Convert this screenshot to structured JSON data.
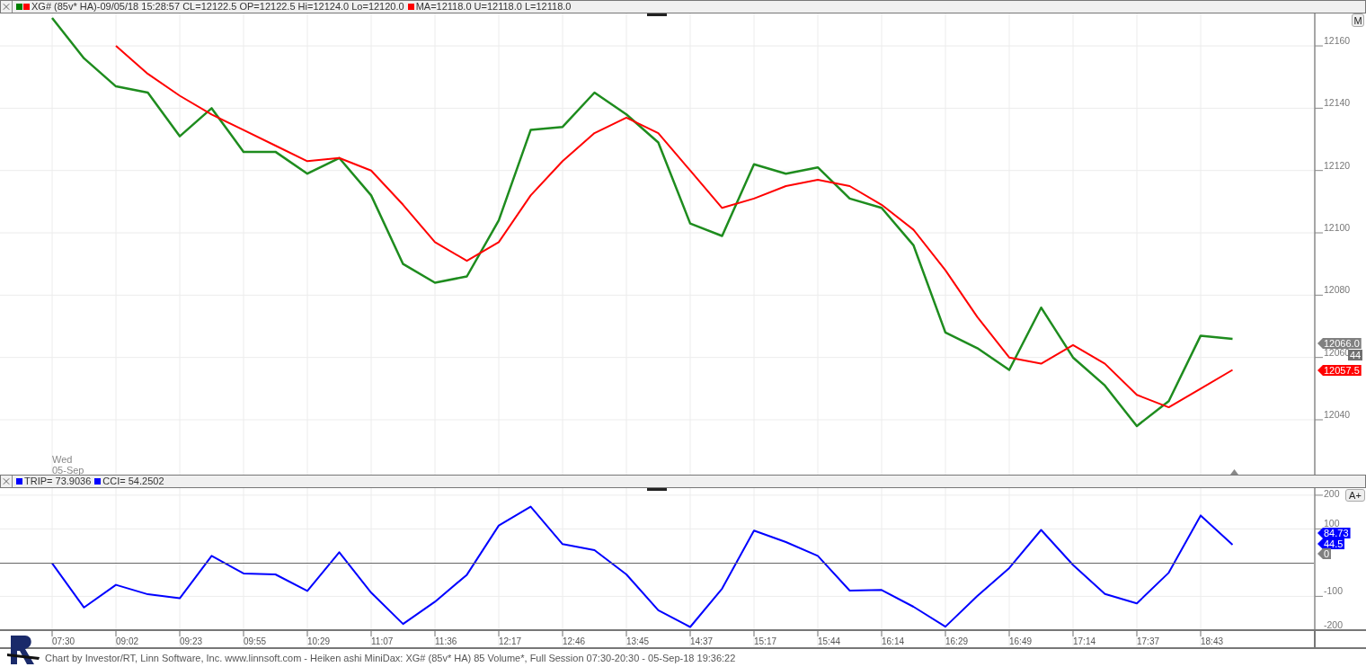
{
  "header": {
    "items": [
      {
        "swatches": [
          {
            "color": "#008000"
          },
          {
            "color": "#ff0000"
          }
        ],
        "text": "XG# (85v* HA)-09/05/18 15:28:57 CL=12122.5 OP=12122.5 Hi=12124.0 Lo=12120.0"
      },
      {
        "swatches": [
          {
            "color": "#ff0000"
          }
        ],
        "text": "MA=12118.0 U=12118.0 L=12118.0"
      }
    ]
  },
  "price_panel": {
    "date_label": [
      "Wed",
      "05-Sep"
    ],
    "scale_button": "M",
    "chart_data": {
      "type": "line",
      "grid": true,
      "categories": [
        null,
        null,
        null,
        null,
        null,
        null,
        null,
        null,
        null,
        null,
        null,
        null,
        null,
        null,
        null,
        null,
        null,
        null,
        null,
        null,
        null,
        null,
        null,
        null,
        null,
        null,
        null,
        null,
        null,
        null,
        null,
        null,
        null,
        null,
        null,
        null,
        null,
        null
      ],
      "ylim": [
        12022.4,
        12170.4
      ],
      "yticks": [
        12040,
        12060,
        12080,
        12100,
        12120,
        12140,
        12160
      ],
      "series": [
        {
          "color": "#1e8c1e",
          "values": [
            12169,
            12156,
            12147,
            12145,
            12131,
            12140,
            12126,
            12126,
            12119,
            12124,
            12112,
            12090,
            12084,
            12086,
            12104,
            12133,
            12134,
            12145,
            12138,
            12129,
            12103,
            12099,
            12122,
            12119,
            12121,
            12111,
            12108,
            12096,
            12068,
            12063,
            12056,
            12076,
            12060,
            12051,
            12038,
            12046,
            12067,
            12066
          ]
        },
        {
          "color": "#ff0000",
          "values": [
            null,
            null,
            12160,
            12151,
            12144,
            12138,
            12133,
            12128,
            12123,
            12124,
            12120,
            12109,
            12097,
            12091,
            12097,
            12112,
            12123,
            12132,
            12137,
            12132,
            12120,
            12108,
            12111,
            12115,
            12117,
            12115,
            12109,
            12101,
            12088,
            12073,
            12060,
            12058,
            12064,
            12058,
            12048,
            12044,
            12050,
            12056
          ]
        }
      ]
    },
    "price_tags": [
      {
        "text": "12066.0",
        "color": "#808080"
      },
      {
        "text": "44",
        "color": "#707070"
      },
      {
        "text": "12057.5",
        "color": "#ff0000"
      }
    ]
  },
  "indicator_header": {
    "items": [
      {
        "swatches": [
          {
            "color": "#0000ff"
          }
        ],
        "text": "TRIP= 73.9036"
      },
      {
        "swatches": [
          {
            "color": "#0000ff"
          }
        ],
        "text": "CCI= 54.2502"
      }
    ]
  },
  "indicator_panel": {
    "scale_button": "A+",
    "chart_data": {
      "type": "line",
      "grid": true,
      "ylim": [
        -251,
        221
      ],
      "yticks": [
        {
          "value": -200,
          "label": "-200"
        },
        {
          "value": -100,
          "label": "-100"
        },
        {
          "value": 100,
          "label": "100"
        },
        {
          "value": 200,
          "label": "200"
        }
      ],
      "categories": [
        "07:30",
        null,
        "09:02",
        null,
        "09:23",
        null,
        "09:55",
        null,
        "10:29",
        null,
        "11:07",
        null,
        "11:36",
        null,
        "12:17",
        null,
        "12:46",
        null,
        "13:45",
        null,
        "14:37",
        null,
        "15:17",
        null,
        "15:44",
        null,
        "16:14",
        null,
        "16:29",
        null,
        "16:49",
        null,
        "17:14",
        null,
        "17:37",
        null,
        "18:43",
        null
      ],
      "series": [
        {
          "color": "#0000ff",
          "values": [
            -2,
            -133,
            -66,
            -94,
            -106,
            20,
            -32,
            -35,
            -84,
            31,
            -89,
            -182,
            -116,
            -36,
            110,
            166,
            55,
            37,
            -35,
            -141,
            -191,
            -77,
            95,
            61,
            20,
            -83,
            -81,
            -131,
            -190,
            -99,
            -16,
            97,
            -7,
            -93,
            -121,
            -30,
            140,
            53
          ]
        }
      ]
    },
    "value_tags": [
      {
        "text": "84.73",
        "color": "#0000ff"
      },
      {
        "text": "44.5",
        "color": "#0000ff"
      },
      {
        "text": "0",
        "color": "#808080"
      }
    ]
  },
  "footer": {
    "text": "Chart by Investor/RT, Linn Software, Inc. www.linnsoft.com - Heiken ashi MiniDax: XG# (85v* HA) 85 Volume*, Full Session 07:30-20:30 - 05-Sep-18 19:36:22"
  }
}
